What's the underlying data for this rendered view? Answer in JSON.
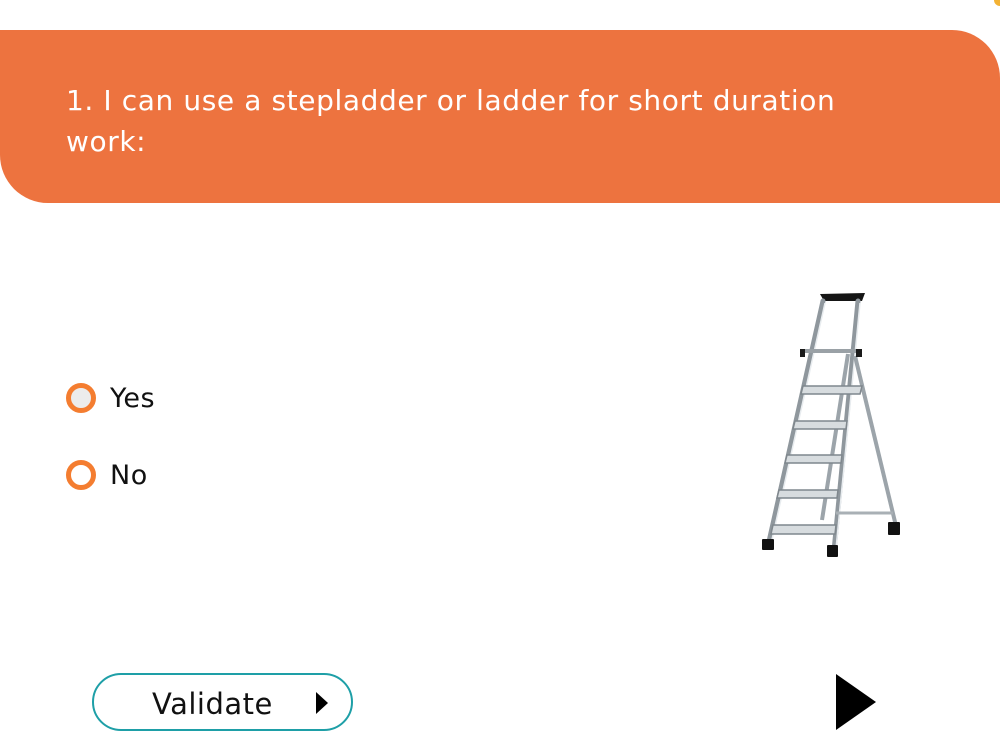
{
  "question": {
    "text": "1. I can use a stepladder or ladder for short duration work:"
  },
  "answers": [
    {
      "label": "Yes"
    },
    {
      "label": "No"
    }
  ],
  "image": {
    "icon": "stepladder-image"
  },
  "controls": {
    "validate_label": "Validate",
    "next_icon": "play-arrow-icon"
  },
  "colors": {
    "banner": "#ed733f",
    "radio_ring": "#f47d30",
    "validate_border": "#1e9fa7",
    "corner_accent": "#f3b234"
  }
}
